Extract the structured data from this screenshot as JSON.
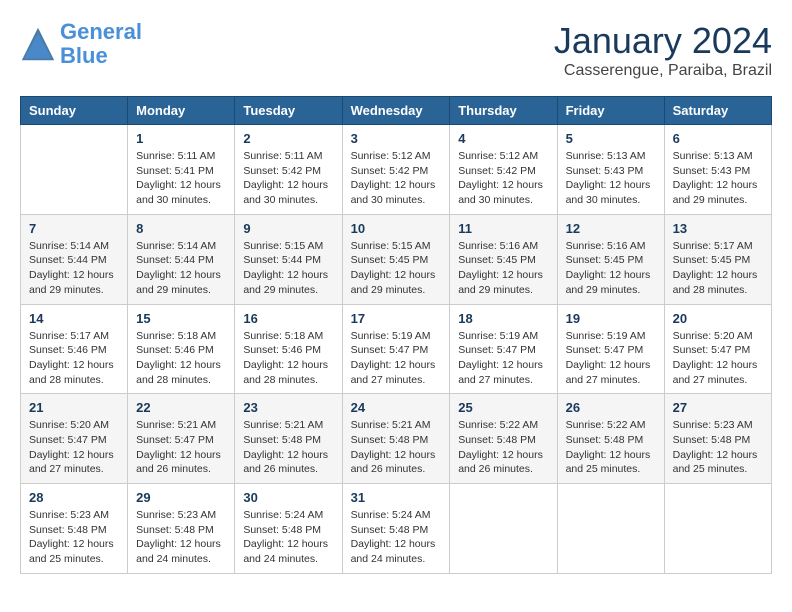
{
  "logo": {
    "line1": "General",
    "line2": "Blue"
  },
  "title": "January 2024",
  "location": "Casserengue, Paraiba, Brazil",
  "headers": [
    "Sunday",
    "Monday",
    "Tuesday",
    "Wednesday",
    "Thursday",
    "Friday",
    "Saturday"
  ],
  "weeks": [
    [
      {
        "day": "",
        "info": ""
      },
      {
        "day": "1",
        "info": "Sunrise: 5:11 AM\nSunset: 5:41 PM\nDaylight: 12 hours\nand 30 minutes."
      },
      {
        "day": "2",
        "info": "Sunrise: 5:11 AM\nSunset: 5:42 PM\nDaylight: 12 hours\nand 30 minutes."
      },
      {
        "day": "3",
        "info": "Sunrise: 5:12 AM\nSunset: 5:42 PM\nDaylight: 12 hours\nand 30 minutes."
      },
      {
        "day": "4",
        "info": "Sunrise: 5:12 AM\nSunset: 5:42 PM\nDaylight: 12 hours\nand 30 minutes."
      },
      {
        "day": "5",
        "info": "Sunrise: 5:13 AM\nSunset: 5:43 PM\nDaylight: 12 hours\nand 30 minutes."
      },
      {
        "day": "6",
        "info": "Sunrise: 5:13 AM\nSunset: 5:43 PM\nDaylight: 12 hours\nand 29 minutes."
      }
    ],
    [
      {
        "day": "7",
        "info": "Sunrise: 5:14 AM\nSunset: 5:44 PM\nDaylight: 12 hours\nand 29 minutes."
      },
      {
        "day": "8",
        "info": "Sunrise: 5:14 AM\nSunset: 5:44 PM\nDaylight: 12 hours\nand 29 minutes."
      },
      {
        "day": "9",
        "info": "Sunrise: 5:15 AM\nSunset: 5:44 PM\nDaylight: 12 hours\nand 29 minutes."
      },
      {
        "day": "10",
        "info": "Sunrise: 5:15 AM\nSunset: 5:45 PM\nDaylight: 12 hours\nand 29 minutes."
      },
      {
        "day": "11",
        "info": "Sunrise: 5:16 AM\nSunset: 5:45 PM\nDaylight: 12 hours\nand 29 minutes."
      },
      {
        "day": "12",
        "info": "Sunrise: 5:16 AM\nSunset: 5:45 PM\nDaylight: 12 hours\nand 29 minutes."
      },
      {
        "day": "13",
        "info": "Sunrise: 5:17 AM\nSunset: 5:45 PM\nDaylight: 12 hours\nand 28 minutes."
      }
    ],
    [
      {
        "day": "14",
        "info": "Sunrise: 5:17 AM\nSunset: 5:46 PM\nDaylight: 12 hours\nand 28 minutes."
      },
      {
        "day": "15",
        "info": "Sunrise: 5:18 AM\nSunset: 5:46 PM\nDaylight: 12 hours\nand 28 minutes."
      },
      {
        "day": "16",
        "info": "Sunrise: 5:18 AM\nSunset: 5:46 PM\nDaylight: 12 hours\nand 28 minutes."
      },
      {
        "day": "17",
        "info": "Sunrise: 5:19 AM\nSunset: 5:47 PM\nDaylight: 12 hours\nand 27 minutes."
      },
      {
        "day": "18",
        "info": "Sunrise: 5:19 AM\nSunset: 5:47 PM\nDaylight: 12 hours\nand 27 minutes."
      },
      {
        "day": "19",
        "info": "Sunrise: 5:19 AM\nSunset: 5:47 PM\nDaylight: 12 hours\nand 27 minutes."
      },
      {
        "day": "20",
        "info": "Sunrise: 5:20 AM\nSunset: 5:47 PM\nDaylight: 12 hours\nand 27 minutes."
      }
    ],
    [
      {
        "day": "21",
        "info": "Sunrise: 5:20 AM\nSunset: 5:47 PM\nDaylight: 12 hours\nand 27 minutes."
      },
      {
        "day": "22",
        "info": "Sunrise: 5:21 AM\nSunset: 5:47 PM\nDaylight: 12 hours\nand 26 minutes."
      },
      {
        "day": "23",
        "info": "Sunrise: 5:21 AM\nSunset: 5:48 PM\nDaylight: 12 hours\nand 26 minutes."
      },
      {
        "day": "24",
        "info": "Sunrise: 5:21 AM\nSunset: 5:48 PM\nDaylight: 12 hours\nand 26 minutes."
      },
      {
        "day": "25",
        "info": "Sunrise: 5:22 AM\nSunset: 5:48 PM\nDaylight: 12 hours\nand 26 minutes."
      },
      {
        "day": "26",
        "info": "Sunrise: 5:22 AM\nSunset: 5:48 PM\nDaylight: 12 hours\nand 25 minutes."
      },
      {
        "day": "27",
        "info": "Sunrise: 5:23 AM\nSunset: 5:48 PM\nDaylight: 12 hours\nand 25 minutes."
      }
    ],
    [
      {
        "day": "28",
        "info": "Sunrise: 5:23 AM\nSunset: 5:48 PM\nDaylight: 12 hours\nand 25 minutes."
      },
      {
        "day": "29",
        "info": "Sunrise: 5:23 AM\nSunset: 5:48 PM\nDaylight: 12 hours\nand 24 minutes."
      },
      {
        "day": "30",
        "info": "Sunrise: 5:24 AM\nSunset: 5:48 PM\nDaylight: 12 hours\nand 24 minutes."
      },
      {
        "day": "31",
        "info": "Sunrise: 5:24 AM\nSunset: 5:48 PM\nDaylight: 12 hours\nand 24 minutes."
      },
      {
        "day": "",
        "info": ""
      },
      {
        "day": "",
        "info": ""
      },
      {
        "day": "",
        "info": ""
      }
    ]
  ]
}
